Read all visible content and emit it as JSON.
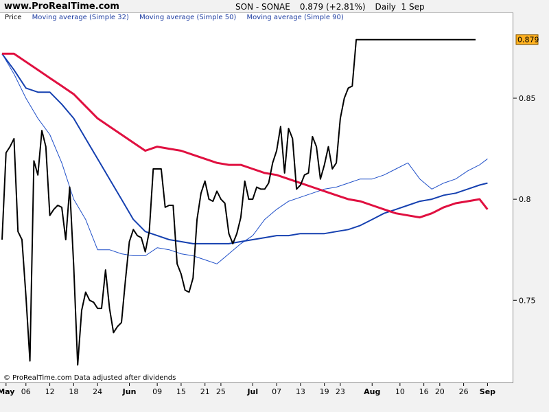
{
  "site": {
    "title": "www.ProRealTime.com"
  },
  "header": {
    "symbol": "SON - SONAE",
    "quote": "0.879 (+2.81%)",
    "period": "Daily  1 Sep"
  },
  "legend": {
    "price": "Price",
    "ma32": "Moving average (Simple 32)",
    "ma50": "Moving average (Simple 50)",
    "ma90": "Moving average (Simple 90)"
  },
  "footer": {
    "copyright": "© ProRealTime.com  Data adjusted after dividends"
  },
  "last_badge": "0.879",
  "colors": {
    "price": "#000000",
    "ma32": "#1f4fc8",
    "ma50": "#1540b0",
    "ma90": "#e01040",
    "ma_red_thin": "#e04060",
    "badge": "#ffb020",
    "tick": "#000000"
  },
  "chart_data": {
    "type": "line",
    "title": "SON - SONAE",
    "xlabel": "",
    "ylabel": "",
    "ylim": [
      0.71,
      0.885
    ],
    "y_ticks": [
      0.75,
      0.8,
      0.85
    ],
    "y_tick_labels": [
      "0.75",
      "0.8",
      "0.85"
    ],
    "x_tick_labels": [
      {
        "label": "May",
        "month": true
      },
      {
        "label": "06",
        "month": false
      },
      {
        "label": "12",
        "month": false
      },
      {
        "label": "18",
        "month": false
      },
      {
        "label": "24",
        "month": false
      },
      {
        "label": "Jun",
        "month": true
      },
      {
        "label": "09",
        "month": false
      },
      {
        "label": "15",
        "month": false
      },
      {
        "label": "21",
        "month": false
      },
      {
        "label": "25",
        "month": false
      },
      {
        "label": "Jul",
        "month": true
      },
      {
        "label": "07",
        "month": false
      },
      {
        "label": "13",
        "month": false
      },
      {
        "label": "19",
        "month": false
      },
      {
        "label": "23",
        "month": false
      },
      {
        "label": "Aug",
        "month": true
      },
      {
        "label": "10",
        "month": false
      },
      {
        "label": "16",
        "month": false
      },
      {
        "label": "20",
        "month": false
      },
      {
        "label": "26",
        "month": false
      },
      {
        "label": "Sep",
        "month": true
      }
    ],
    "x_ticks": [
      1,
      6,
      12,
      18,
      24,
      32,
      39,
      45,
      51,
      55,
      63,
      69,
      75,
      81,
      85,
      93,
      100,
      106,
      110,
      116,
      122
    ],
    "x_range": [
      0,
      124
    ],
    "series": [
      {
        "name": "Price",
        "style": "price",
        "x": [
          0,
          1,
          2,
          3,
          4,
          5,
          6,
          7,
          8,
          9,
          10,
          11,
          12,
          13,
          14,
          15,
          16,
          17,
          18,
          19,
          20,
          21,
          22,
          23,
          24,
          25,
          26,
          27,
          28,
          29,
          30,
          31,
          32,
          33,
          34,
          35,
          36,
          37,
          38,
          39,
          40,
          41,
          42,
          43,
          44,
          45,
          46,
          47,
          48,
          49,
          50,
          51,
          52,
          53,
          54,
          55,
          56,
          57,
          58,
          59,
          60,
          61,
          62,
          63,
          64,
          65,
          66,
          67,
          68,
          69,
          70,
          71,
          72,
          73,
          74,
          75,
          76,
          77,
          78,
          79,
          80,
          81,
          82,
          83,
          84,
          85,
          86,
          87,
          88,
          89,
          90,
          91,
          92,
          93,
          94,
          95,
          96,
          97,
          98,
          99,
          100,
          101,
          102,
          103,
          104,
          105,
          106,
          107,
          108,
          109,
          110,
          111,
          112,
          113,
          114,
          115,
          116,
          117,
          118,
          119,
          120,
          121,
          122
        ],
        "values": [
          0.78,
          0.823,
          0.826,
          0.83,
          0.784,
          0.78,
          0.752,
          0.72,
          0.819,
          0.812,
          0.834,
          0.826,
          0.792,
          0.795,
          0.797,
          0.796,
          0.78,
          0.806,
          0.767,
          0.718,
          0.745,
          0.754,
          0.75,
          0.749,
          0.746,
          0.746,
          0.765,
          0.746,
          0.734,
          0.737,
          0.739,
          0.76,
          0.779,
          0.785,
          0.782,
          0.781,
          0.774,
          0.784,
          0.815,
          0.815,
          0.815,
          0.796,
          0.797,
          0.797,
          0.768,
          0.763,
          0.755,
          0.754,
          0.761,
          0.79,
          0.803,
          0.809,
          0.8,
          0.799,
          0.804,
          0.8,
          0.798,
          0.783,
          0.778,
          0.783,
          0.791,
          0.809,
          0.8,
          0.8,
          0.806,
          0.805,
          0.805,
          0.808,
          0.818,
          0.824,
          0.836,
          0.813,
          0.835,
          0.83,
          0.805,
          0.807,
          0.812,
          0.813,
          0.831,
          0.826,
          0.81,
          0.817,
          0.826,
          0.815,
          0.818,
          0.84,
          0.85,
          0.855,
          0.856,
          0.879,
          0.879,
          0.879,
          0.879,
          0.879,
          0.879,
          0.879,
          0.879,
          0.879,
          0.879,
          0.879,
          0.879,
          0.879,
          0.879,
          0.879,
          0.879,
          0.879,
          0.879,
          0.879,
          0.879,
          0.879,
          0.879,
          0.879,
          0.879,
          0.879,
          0.879,
          0.879,
          0.879,
          0.879,
          0.879,
          0.879,
          0.879,
          0.879,
          0.879
        ]
      },
      {
        "name": "Moving average (Simple 32)",
        "style": "ma32",
        "x": [
          0,
          3,
          6,
          9,
          12,
          15,
          18,
          21,
          24,
          27,
          30,
          33,
          36,
          39,
          42,
          45,
          48,
          51,
          54,
          57,
          60,
          63,
          66,
          69,
          72,
          75,
          78,
          81,
          84,
          87,
          90,
          93,
          96,
          99,
          102,
          105,
          108,
          111,
          114,
          117,
          120,
          122
        ],
        "values": [
          0.872,
          0.862,
          0.85,
          0.84,
          0.832,
          0.818,
          0.8,
          0.79,
          0.775,
          0.775,
          0.773,
          0.772,
          0.772,
          0.776,
          0.775,
          0.773,
          0.772,
          0.77,
          0.768,
          0.773,
          0.778,
          0.782,
          0.79,
          0.795,
          0.799,
          0.801,
          0.803,
          0.805,
          0.806,
          0.808,
          0.81,
          0.81,
          0.812,
          0.815,
          0.818,
          0.81,
          0.805,
          0.808,
          0.81,
          0.814,
          0.817,
          0.82
        ]
      },
      {
        "name": "Moving average (Simple 50)",
        "style": "ma50",
        "x": [
          0,
          3,
          6,
          9,
          12,
          15,
          18,
          21,
          24,
          27,
          30,
          33,
          36,
          39,
          42,
          45,
          48,
          51,
          54,
          57,
          60,
          63,
          66,
          69,
          72,
          75,
          78,
          81,
          84,
          87,
          90,
          93,
          96,
          99,
          102,
          105,
          108,
          111,
          114,
          117,
          120,
          122
        ],
        "values": [
          0.872,
          0.864,
          0.855,
          0.853,
          0.853,
          0.847,
          0.84,
          0.83,
          0.82,
          0.81,
          0.8,
          0.79,
          0.784,
          0.782,
          0.78,
          0.779,
          0.778,
          0.778,
          0.778,
          0.778,
          0.779,
          0.78,
          0.781,
          0.782,
          0.782,
          0.783,
          0.783,
          0.783,
          0.784,
          0.785,
          0.787,
          0.79,
          0.793,
          0.795,
          0.797,
          0.799,
          0.8,
          0.802,
          0.803,
          0.805,
          0.807,
          0.808
        ]
      },
      {
        "name": "Moving average (Simple 90)",
        "style": "ma90",
        "x": [
          0,
          3,
          6,
          9,
          12,
          15,
          18,
          21,
          24,
          27,
          30,
          33,
          36,
          39,
          42,
          45,
          48,
          51,
          54,
          57,
          60,
          63,
          66,
          69,
          72,
          75,
          78,
          81,
          84,
          87,
          90,
          93,
          96,
          99,
          102,
          105,
          108,
          111,
          114,
          117,
          120,
          122
        ],
        "values": [
          0.872,
          0.872,
          0.868,
          0.864,
          0.86,
          0.856,
          0.852,
          0.846,
          0.84,
          0.836,
          0.832,
          0.828,
          0.824,
          0.826,
          0.825,
          0.824,
          0.822,
          0.82,
          0.818,
          0.817,
          0.817,
          0.815,
          0.813,
          0.812,
          0.81,
          0.808,
          0.806,
          0.804,
          0.802,
          0.8,
          0.799,
          0.797,
          0.795,
          0.793,
          0.792,
          0.791,
          0.793,
          0.796,
          0.798,
          0.799,
          0.8,
          0.795
        ]
      }
    ]
  }
}
